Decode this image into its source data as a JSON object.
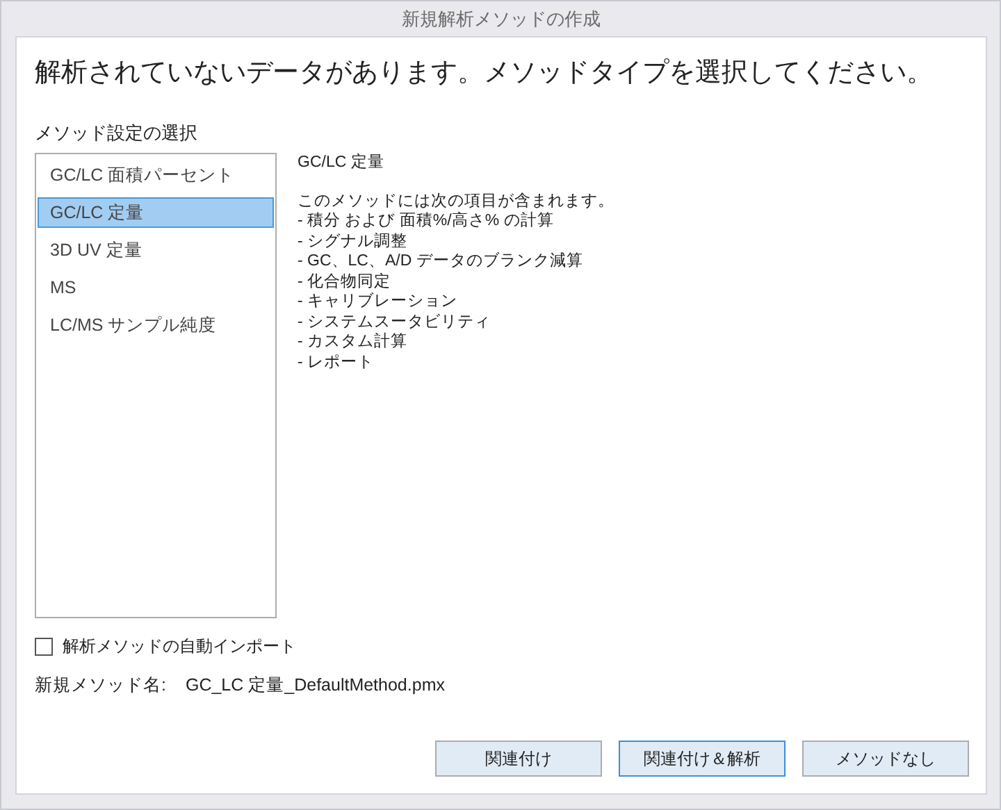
{
  "window": {
    "title": "新規解析メソッドの作成"
  },
  "heading": "解析されていないデータがあります。メソッドタイプを選択してください。",
  "method_settings": {
    "label": "メソッド設定の選択",
    "items": [
      {
        "label": "GC/LC 面積パーセント",
        "selected": false
      },
      {
        "label": "GC/LC 定量",
        "selected": true
      },
      {
        "label": "3D UV 定量",
        "selected": false
      },
      {
        "label": "MS",
        "selected": false
      },
      {
        "label": "LC/MS サンプル純度",
        "selected": false
      }
    ]
  },
  "description": {
    "title": "GC/LC 定量",
    "intro": "このメソッドには次の項目が含まれます。",
    "lines": [
      "- 積分 および 面積%/高さ% の計算",
      "- シグナル調整",
      "- GC、LC、A/D データのブランク減算",
      "- 化合物同定",
      "- キャリブレーション",
      "- システムスータビリティ",
      "- カスタム計算",
      "- レポート"
    ]
  },
  "auto_import": {
    "label": "解析メソッドの自動インポート",
    "checked": false
  },
  "new_method_name": {
    "label": "新規メソッド名:",
    "value": "GC_LC 定量_DefaultMethod.pmx"
  },
  "buttons": [
    {
      "label": "関連付け",
      "focused": false
    },
    {
      "label": "関連付け＆解析",
      "focused": true
    },
    {
      "label": "メソッドなし",
      "focused": false
    }
  ]
}
